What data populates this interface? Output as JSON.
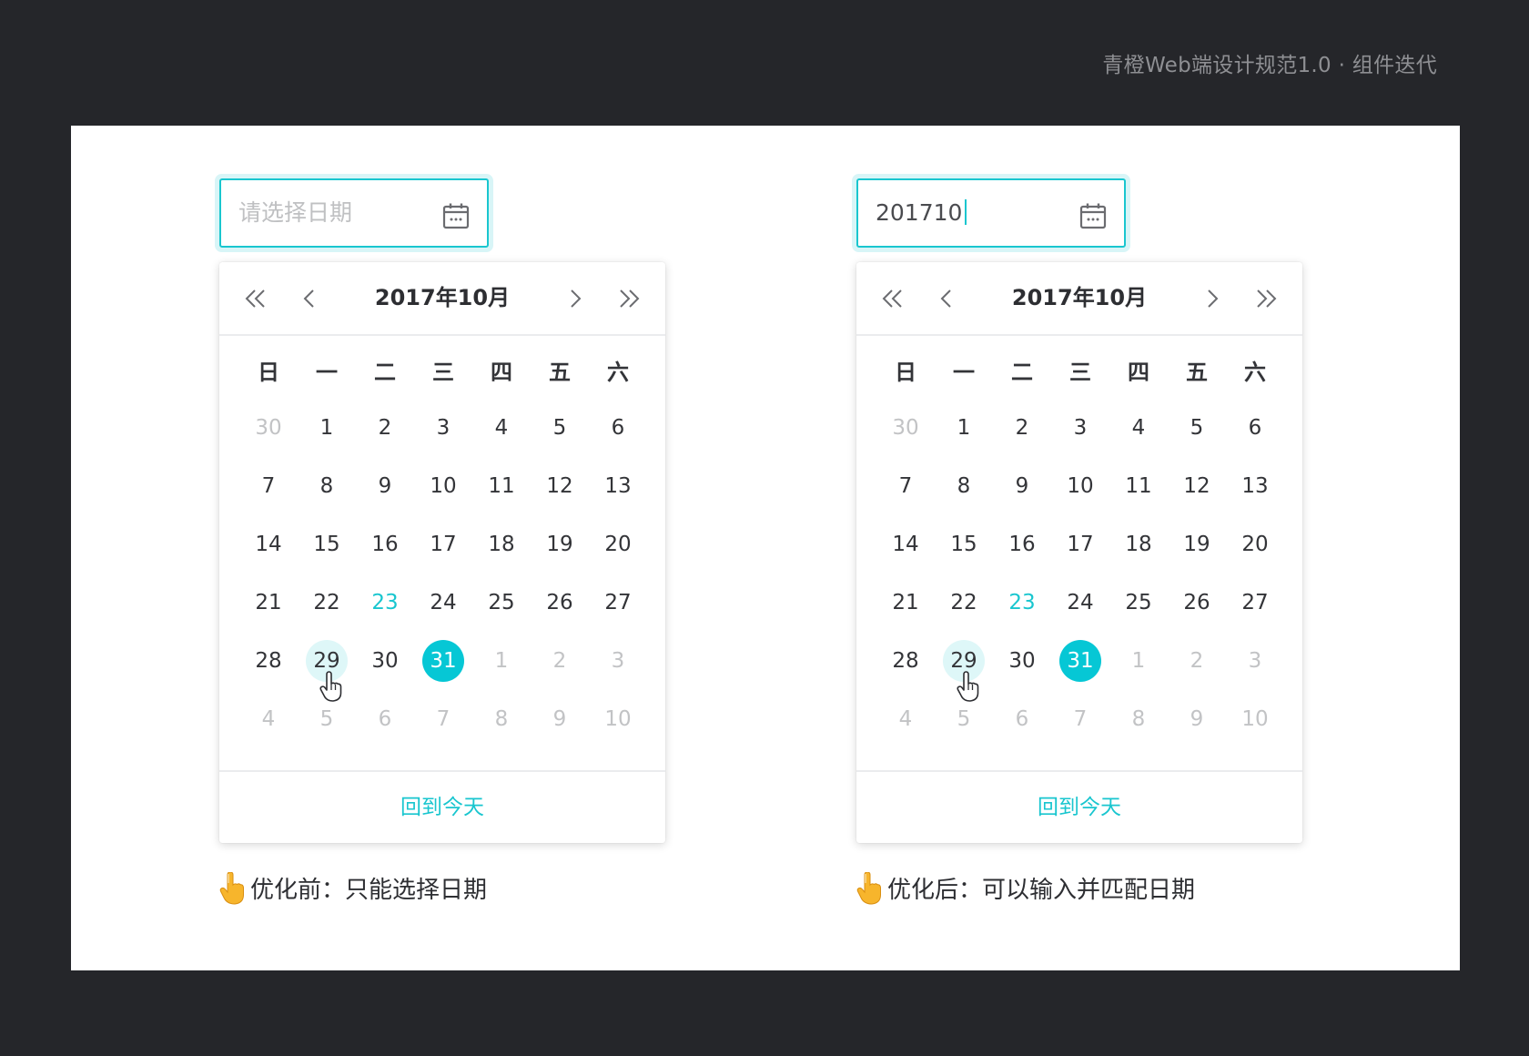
{
  "header": {
    "title": "青橙Web端设计规范1.0 · 组件迭代"
  },
  "colors": {
    "accent": "#19c6cf",
    "selected": "#06c7d5",
    "hover": "#def7f8",
    "background": "#25262a"
  },
  "icons": {
    "calendar": "calendar-icon",
    "prev_year": "double-chevron-left-icon",
    "prev_month": "chevron-left-icon",
    "next_month": "chevron-right-icon",
    "next_year": "double-chevron-right-icon",
    "cursor": "hand-pointer-icon",
    "caption": "pointing-finger-emoji"
  },
  "calendar_common": {
    "month_title": "2017年10月",
    "weekdays": [
      "日",
      "一",
      "二",
      "三",
      "四",
      "五",
      "六"
    ],
    "weeks": [
      [
        "30",
        "1",
        "2",
        "3",
        "4",
        "5",
        "6"
      ],
      [
        "7",
        "8",
        "9",
        "10",
        "11",
        "12",
        "13"
      ],
      [
        "14",
        "15",
        "16",
        "17",
        "18",
        "19",
        "20"
      ],
      [
        "21",
        "22",
        "23",
        "24",
        "25",
        "26",
        "27"
      ],
      [
        "28",
        "29",
        "30",
        "31",
        "1",
        "2",
        "3"
      ],
      [
        "4",
        "5",
        "6",
        "7",
        "8",
        "9",
        "10"
      ]
    ],
    "today_day": "23",
    "selected_day": "31",
    "hovered_day": "29",
    "footer_label": "回到今天"
  },
  "before": {
    "input": {
      "placeholder": "请选择日期",
      "value": ""
    },
    "caption": "优化前：只能选择日期"
  },
  "after": {
    "input": {
      "placeholder": "",
      "value": "201710"
    },
    "caption": "优化后：可以输入并匹配日期"
  }
}
